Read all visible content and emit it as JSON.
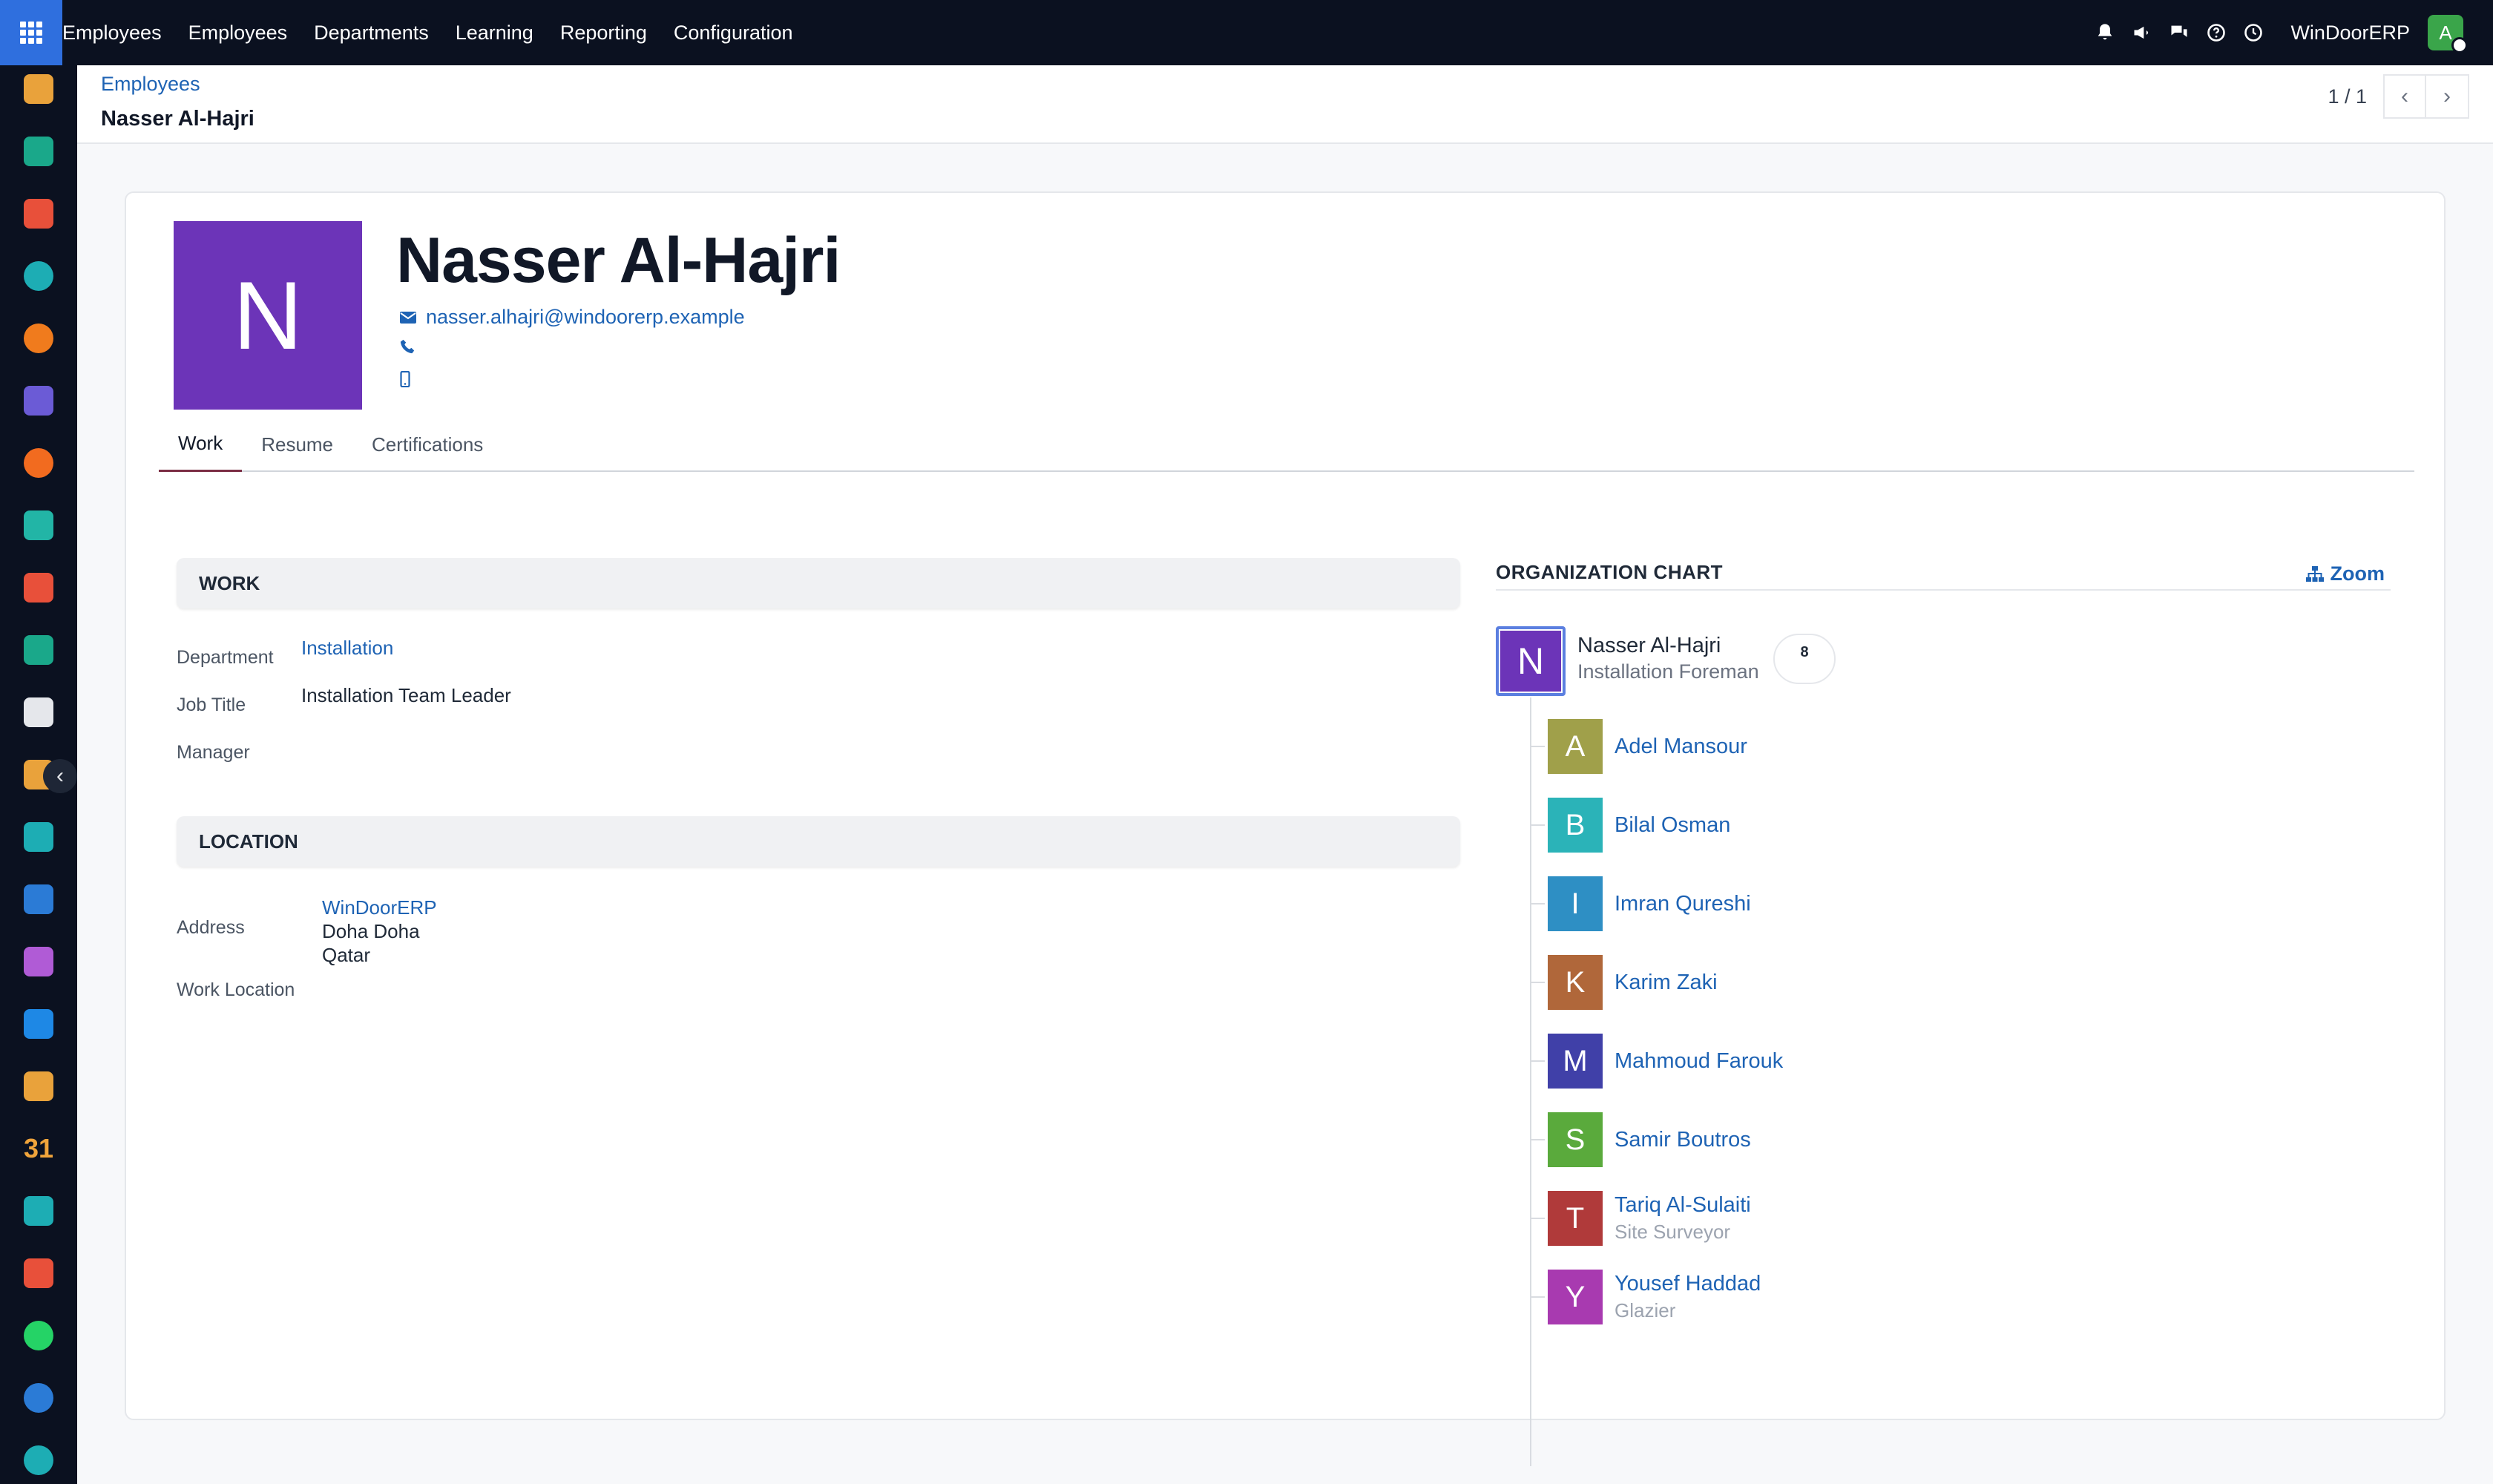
{
  "topbar": {
    "menu": [
      "Employees",
      "Employees",
      "Departments",
      "Learning",
      "Reporting",
      "Configuration"
    ],
    "company": "WinDoorERP",
    "user_initial": "A"
  },
  "sidebar_apps": [
    {
      "name": "app-icon-1",
      "color": "#e9a23b"
    },
    {
      "name": "contacts-app-icon",
      "color": "#1aa88a"
    },
    {
      "name": "reporting-app-icon",
      "color": "#e8503a"
    },
    {
      "name": "dashboard-app-icon",
      "color": "#1dadb4"
    },
    {
      "name": "discuss-app-icon",
      "color": "#f07b1d"
    },
    {
      "name": "mail-app-icon",
      "color": "#6b5bd6"
    },
    {
      "name": "chat-app-icon",
      "color": "#f26b1f"
    },
    {
      "name": "project-app-icon",
      "color": "#22b5a6"
    },
    {
      "name": "analytics-app-icon",
      "color": "#e8503a"
    },
    {
      "name": "employees-app-icon",
      "color": "#1aa88a"
    },
    {
      "name": "inventory-app-icon",
      "color": "#e5e7eb"
    },
    {
      "name": "app-icon-12",
      "color": "#e9a23b"
    },
    {
      "name": "todo-app-icon",
      "color": "#1dadb4"
    },
    {
      "name": "knowledge-app-icon",
      "color": "#2b7bd6"
    },
    {
      "name": "product-app-icon",
      "color": "#b05bd6"
    },
    {
      "name": "invoicing-app-icon",
      "color": "#1e88e5"
    },
    {
      "name": "team-app-icon",
      "color": "#e9a23b"
    },
    {
      "name": "calendar-app-icon",
      "color": "#f0a43b"
    },
    {
      "name": "sign-app-icon",
      "color": "#1dadb4"
    },
    {
      "name": "website-app-icon",
      "color": "#e8503a"
    },
    {
      "name": "whatsapp-app-icon",
      "color": "#25d366"
    },
    {
      "name": "timer-app-icon",
      "color": "#2b7bd6"
    },
    {
      "name": "apps-app-icon",
      "color": "#1dadb4"
    }
  ],
  "breadcrumb": {
    "parent": "Employees",
    "current": "Nasser Al-Hajri"
  },
  "pager": {
    "value": "1 / 1"
  },
  "employee": {
    "initial": "N",
    "name": "Nasser Al-Hajri",
    "email": "nasser.alhajri@windoorerp.example",
    "avatar_color": "#6c34b8"
  },
  "tabs": [
    "Work",
    "Resume",
    "Certifications"
  ],
  "work": {
    "section_title": "WORK",
    "department_label": "Department",
    "department_value": "Installation",
    "job_label": "Job Title",
    "job_value": "Installation Team Leader",
    "manager_label": "Manager"
  },
  "location": {
    "section_title": "LOCATION",
    "address_label": "Address",
    "address_company": "WinDoorERP",
    "address_line1": "Doha Doha",
    "address_line2": "Qatar",
    "work_location_label": "Work Location"
  },
  "org_chart": {
    "title": "ORGANIZATION CHART",
    "zoom_label": "Zoom",
    "main": {
      "initial": "N",
      "name": "Nasser Al-Hajri",
      "job": "Installation Foreman",
      "count": "8"
    },
    "subordinates": [
      {
        "initial": "A",
        "name": "Adel Mansour",
        "job": "",
        "color": "#a0a04a"
      },
      {
        "initial": "B",
        "name": "Bilal Osman",
        "job": "",
        "color": "#2bb3b8"
      },
      {
        "initial": "I",
        "name": "Imran Qureshi",
        "job": "",
        "color": "#2e8fc4"
      },
      {
        "initial": "K",
        "name": "Karim Zaki",
        "job": "",
        "color": "#b0673a"
      },
      {
        "initial": "M",
        "name": "Mahmoud Farouk",
        "job": "",
        "color": "#4040a8"
      },
      {
        "initial": "S",
        "name": "Samir Boutros",
        "job": "",
        "color": "#5aaa3c"
      },
      {
        "initial": "T",
        "name": "Tariq Al-Sulaiti",
        "job": "Site Surveyor",
        "color": "#b03a3a"
      },
      {
        "initial": "Y",
        "name": "Yousef Haddad",
        "job": "Glazier",
        "color": "#a83ab0"
      }
    ]
  }
}
